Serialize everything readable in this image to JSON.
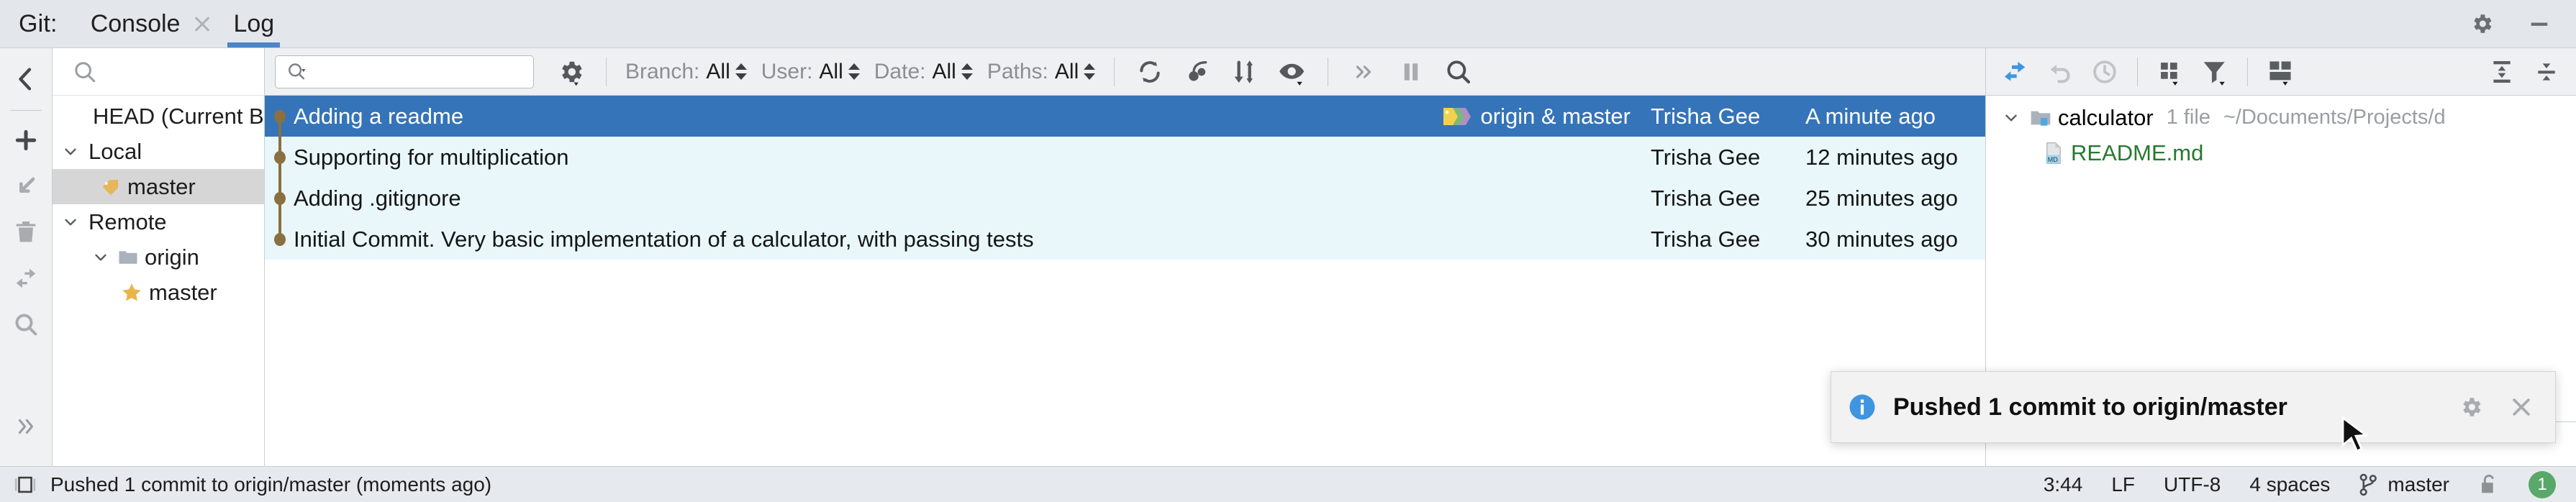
{
  "window": {
    "tool_label": "Git:",
    "settings_icon": "gear-icon",
    "minimize_icon": "minimize-icon"
  },
  "tabs": [
    {
      "label": "Console",
      "active": false,
      "closable": true
    },
    {
      "label": "Log",
      "active": true,
      "closable": false
    }
  ],
  "left_strip": {
    "icons": [
      "collapse-left-icon",
      "add-icon",
      "checkout-icon",
      "delete-icon",
      "merge-icon",
      "search-icon",
      "expand-more-icon"
    ]
  },
  "branch_panel": {
    "search_placeholder": "",
    "search_icon": "search-icon",
    "tree": [
      {
        "label": "HEAD (Current Branch)",
        "indent": 1,
        "icon": "none",
        "expander": "none",
        "selected": false
      },
      {
        "label": "Local",
        "indent": 0,
        "icon": "none",
        "expander": "expanded",
        "selected": false
      },
      {
        "label": "master",
        "indent": 2,
        "icon": "branch-tag-icon",
        "expander": "none",
        "selected": true
      },
      {
        "label": "Remote",
        "indent": 0,
        "icon": "none",
        "expander": "expanded",
        "selected": false
      },
      {
        "label": "origin",
        "indent": 1,
        "icon": "folder-icon",
        "expander": "expanded",
        "selected": false
      },
      {
        "label": "master",
        "indent": 3,
        "icon": "favorite-star-icon",
        "expander": "none",
        "selected": false
      }
    ]
  },
  "log_toolbar": {
    "text_filter_value": "",
    "text_filter_icon": "search-dropdown-icon",
    "settings_icon": "gear-dropdown-icon",
    "filters": [
      {
        "label": "Branch:",
        "value": "All"
      },
      {
        "label": "User:",
        "value": "All"
      },
      {
        "label": "Date:",
        "value": "All"
      },
      {
        "label": "Paths:",
        "value": "All"
      }
    ],
    "actions": [
      "refresh-icon",
      "cherry-pick-icon",
      "intelli-sort-icon",
      "show-details-icon",
      "more-actions-icon",
      "pause-icon",
      "search-icon"
    ]
  },
  "commit_table": {
    "rows": [
      {
        "subject": "Adding a readme",
        "refs": "origin & master",
        "refs_icon": "branch-labels-icon",
        "author": "Trisha Gee",
        "date": "A minute ago",
        "selected": true
      },
      {
        "subject": "Supporting for multiplication",
        "refs": "",
        "refs_icon": "",
        "author": "Trisha Gee",
        "date": "12 minutes ago",
        "selected": false
      },
      {
        "subject": "Adding .gitignore",
        "refs": "",
        "refs_icon": "",
        "author": "Trisha Gee",
        "date": "25 minutes ago",
        "selected": false
      },
      {
        "subject": "Initial Commit. Very basic implementation of a calculator, with passing tests",
        "refs": "",
        "refs_icon": "",
        "author": "Trisha Gee",
        "date": "30 minutes ago",
        "selected": false
      }
    ]
  },
  "right_panel": {
    "actions": [
      "apply-changes-icon",
      "revert-icon",
      "history-icon",
      "group-by-icon",
      "filter-icon",
      "layout-icon",
      "expand-all-icon",
      "collapse-all-icon"
    ],
    "files": [
      {
        "name": "calculator",
        "meta_count": "1 file",
        "meta_path": "~/Documents/Projects/d",
        "icon": "module-folder-icon",
        "expander": "expanded",
        "indent": 0,
        "green": false
      },
      {
        "name": "README.md",
        "meta_count": "",
        "meta_path": "",
        "icon": "markdown-file-icon",
        "expander": "none",
        "indent": 1,
        "green": true
      }
    ]
  },
  "notification": {
    "icon": "info-icon",
    "message": "Pushed 1 commit to origin/master",
    "settings_icon": "gear-icon",
    "close_icon": "close-icon"
  },
  "status_bar": {
    "memory_icon": "memory-indicator-icon",
    "message": "Pushed 1 commit to origin/master (moments ago)",
    "line_column": "3:44",
    "line_separator": "LF",
    "encoding": "UTF-8",
    "indent": "4 spaces",
    "branch_icon": "git-branch-icon",
    "branch": "master",
    "lock_icon": "unlocked-icon",
    "notification_count": "1"
  },
  "colors": {
    "accent": "#3574b8",
    "selection": "#3574b8",
    "alt_row": "#e9f7fb",
    "graph": "#8a7040",
    "green_file": "#27792f",
    "badge_green": "#59a869"
  }
}
